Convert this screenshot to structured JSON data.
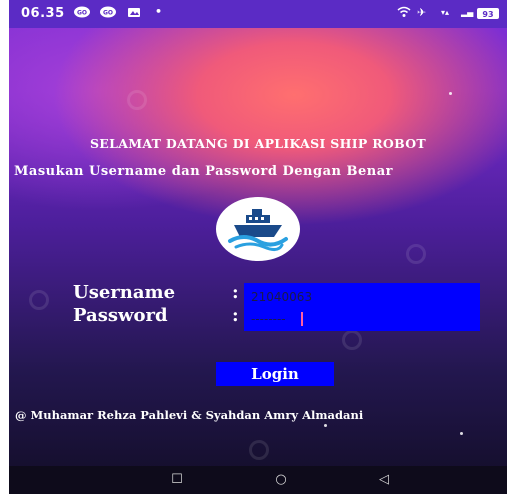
{
  "status_bar": {
    "time": "06.35",
    "battery": "93",
    "icons": [
      "chat-bubble-icon",
      "chat-bubble-icon",
      "image-icon",
      "dot-icon",
      "wifi-icon",
      "airplane-icon",
      "data-speed-icon",
      "signal-icon",
      "battery-icon"
    ]
  },
  "header": {
    "title": "SELAMAT DATANG DI APLIKASI SHIP ROBOT",
    "subtitle": "Masukan Username dan Password Dengan Benar"
  },
  "logo": {
    "icon": "ship-icon",
    "colors": {
      "hull": "#1a4a8a",
      "wave": "#2aa0e0"
    }
  },
  "form": {
    "username_label": "Username",
    "password_label": "Password",
    "colon": ":",
    "username_value": "21040063",
    "password_value": "--------",
    "panel_color": "#0000ff"
  },
  "login": {
    "label": "Login"
  },
  "footer": {
    "credits": "@ Muhamar Rehza Pahlevi &  Syahdan Amry Almadani"
  },
  "nav": {
    "recent": "☐",
    "home": "○",
    "back": "◁"
  },
  "colors": {
    "accent": "#0000ff",
    "status_bar": "#5b2bc5",
    "caret": "#ff5fa0"
  }
}
